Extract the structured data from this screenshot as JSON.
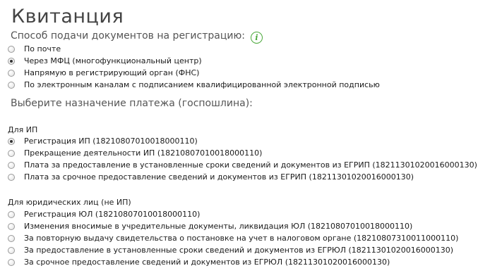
{
  "title": "Квитанция",
  "submission": {
    "label": "Способ подачи документов на регистрацию:",
    "info_icon": "info-icon",
    "options": [
      {
        "label": "По почте",
        "checked": false
      },
      {
        "label": "Через МФЦ (многофункциональный центр)",
        "checked": true
      },
      {
        "label": "Напрямую в регистрирующий орган (ФНС)",
        "checked": false
      },
      {
        "label": "По электронным каналам с подписанием квалифицированной электронной подписью",
        "checked": false
      }
    ]
  },
  "payment": {
    "label": "Выберите назначение платежа (госпошлина):",
    "ip_group": {
      "title": "Для ИП",
      "options": [
        {
          "label": "Регистрация ИП (18210807010018000110)",
          "checked": true
        },
        {
          "label": "Прекращение деятельности ИП (18210807010018000110)",
          "checked": false
        },
        {
          "label": "Плата за предоставление в установленные сроки сведений и документов из ЕГРИП (18211301020016000130)",
          "checked": false
        },
        {
          "label": "Плата за срочное предоставление сведений и документов из ЕГРИП (18211301020016000130)",
          "checked": false
        }
      ]
    },
    "ul_group": {
      "title": "Для юридических лиц (не ИП)",
      "options": [
        {
          "label": "Регистрация ЮЛ (18210807010018000110)",
          "checked": false
        },
        {
          "label": "Изменения вносимые в учредительные документы, ликвидация ЮЛ (18210807010018000110)",
          "checked": false
        },
        {
          "label": "За повторную выдачу свидетельства о постановке на учет в налоговом органе (18210807310011000110)",
          "checked": false
        },
        {
          "label": "За предоставление в установленные сроки сведений и документов из ЕГРЮЛ (18211301020016000130)",
          "checked": false
        },
        {
          "label": "За срочное предоставление сведений и документов из ЕГРЮЛ (18211301020016000130)",
          "checked": false
        }
      ]
    }
  }
}
